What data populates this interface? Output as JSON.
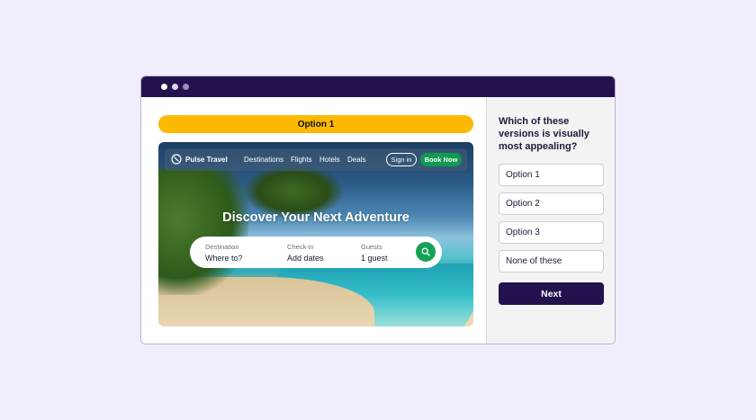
{
  "window": {
    "dots": [
      "close-dot",
      "minimize-dot",
      "maximize-dot"
    ]
  },
  "option_banner": {
    "label": "Option 1"
  },
  "preview": {
    "brand": "Pulse Travel",
    "nav_links": [
      "Destinations",
      "Flights",
      "Hotels",
      "Deals"
    ],
    "signin_label": "Sign in",
    "book_label": "Book Now",
    "hero_title": "Discover Your Next Adventure",
    "search": {
      "destination_label": "Destination",
      "destination_value": "Where to?",
      "checkin_label": "Check-in",
      "checkin_value": "Add dates",
      "guests_label": "Guests",
      "guests_value": "1 guest",
      "button_icon": "search-icon"
    },
    "colors": {
      "accent_green": "#17a158"
    }
  },
  "survey": {
    "question": "Which of these versions is visually most appealing?",
    "options": [
      "Option 1",
      "Option 2",
      "Option 3",
      "None of these"
    ],
    "next_label": "Next"
  },
  "colors": {
    "brand_dark": "#24124f",
    "banner_yellow": "#fdb901",
    "background": "#f1edfd"
  }
}
